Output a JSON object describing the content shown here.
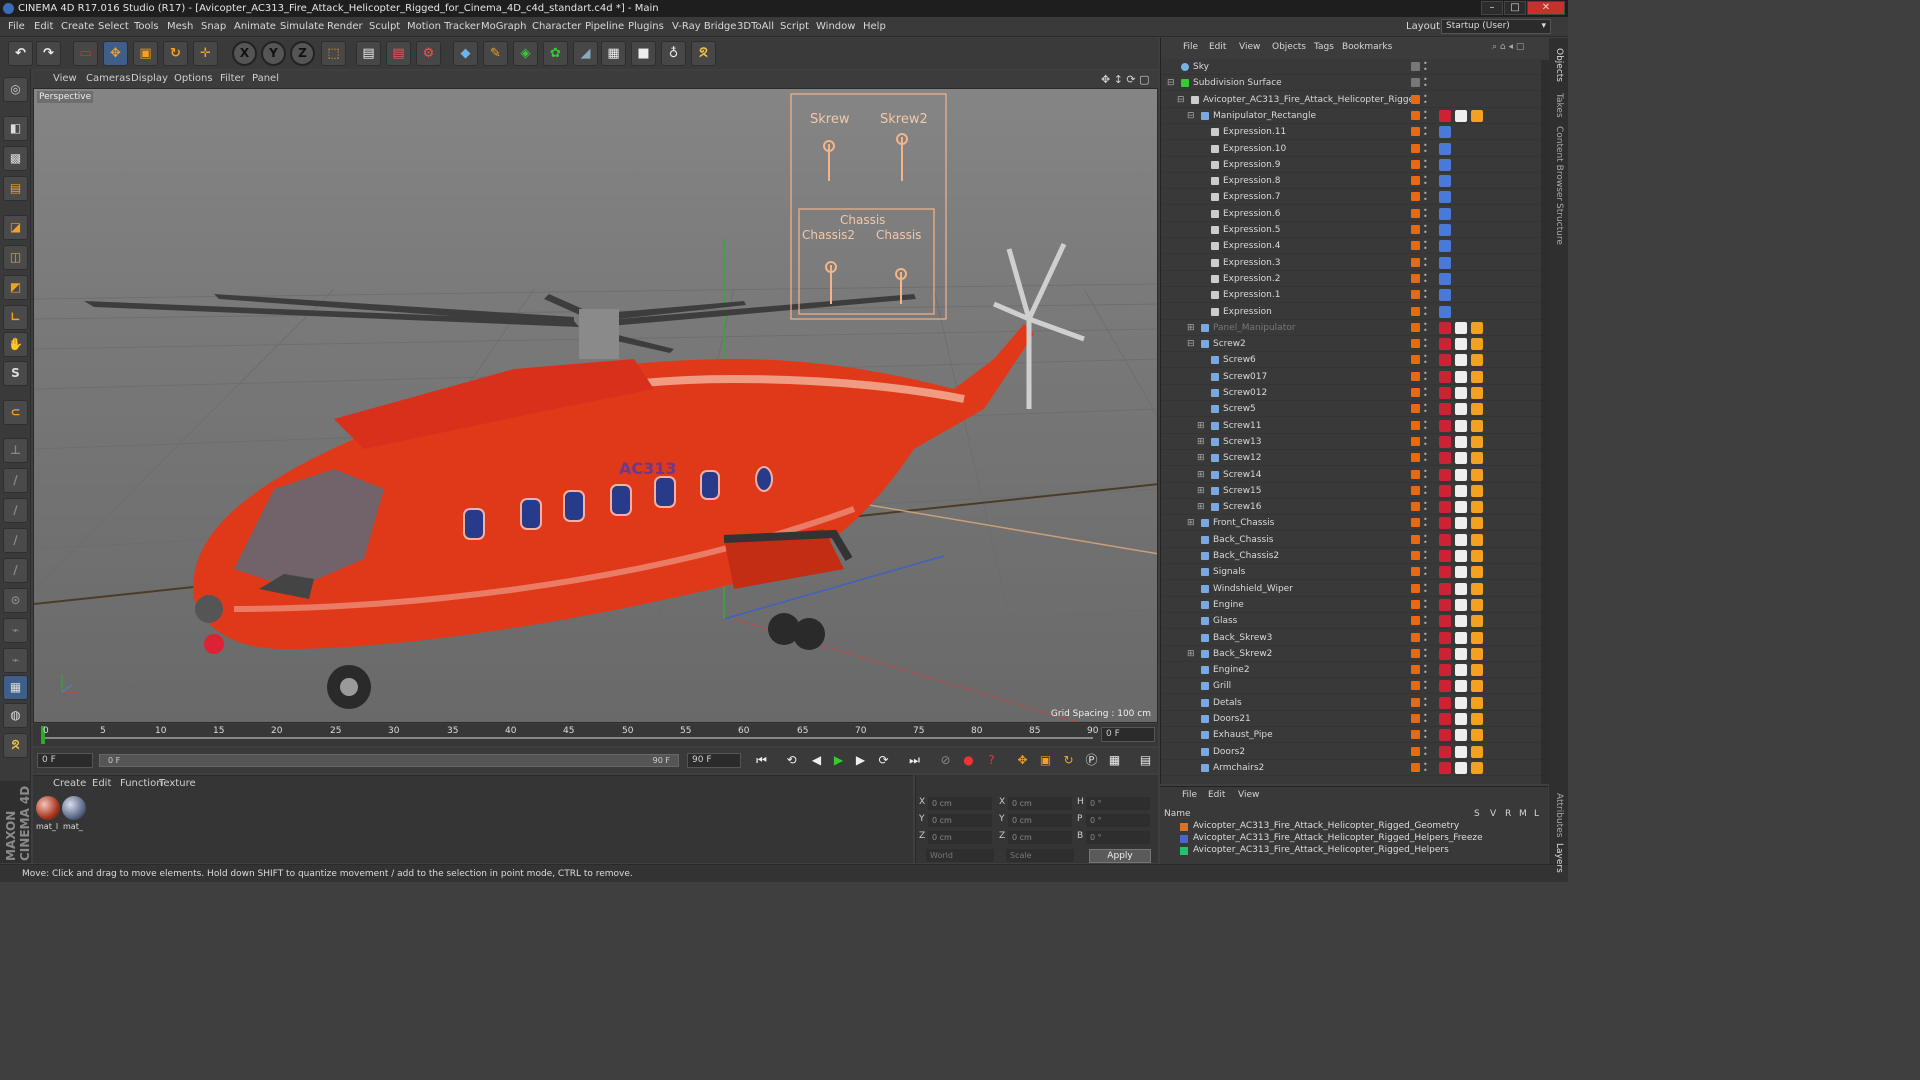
{
  "window": {
    "title": "CINEMA 4D R17.016 Studio (R17) - [Avicopter_AC313_Fire_Attack_Helicopter_Rigged_for_Cinema_4D_c4d_standart.c4d *] - Main"
  },
  "menubar": {
    "items": [
      "File",
      "Edit",
      "Create",
      "Select",
      "Tools",
      "Mesh",
      "Snap",
      "Animate",
      "Simulate",
      "Render",
      "Sculpt",
      "Motion Tracker",
      "MoGraph",
      "Character",
      "Pipeline",
      "Plugins",
      "V-Ray Bridge",
      "3DToAll",
      "Script",
      "Window",
      "Help"
    ],
    "layout_label": "Layout:",
    "layout_value": "Startup (User)"
  },
  "toolbar": {
    "axis_x": "X",
    "axis_y": "Y",
    "axis_z": "Z"
  },
  "viewport": {
    "menu": [
      "View",
      "Cameras",
      "Display",
      "Options",
      "Filter",
      "Panel"
    ],
    "camera_label": "Perspective",
    "grid_spacing": "Grid Spacing : 100 cm",
    "hud": {
      "skrew": "Skrew",
      "skrew2": "Skrew2",
      "chassis": "Chassis",
      "chassis2": "Chassis2",
      "chassis_b": "Chassis"
    },
    "fuselage_text": "AC313"
  },
  "timeline": {
    "ticks": [
      "0",
      "5",
      "10",
      "15",
      "20",
      "25",
      "30",
      "35",
      "40",
      "45",
      "50",
      "55",
      "60",
      "65",
      "70",
      "75",
      "80",
      "85",
      "90"
    ],
    "frame_end_field": "0 F"
  },
  "transport": {
    "start_field": "0 F",
    "range_start": "0 F",
    "range_end": "90 F",
    "end_field": "90 F"
  },
  "material_panel": {
    "menu": [
      "Create",
      "Edit",
      "Function",
      "Texture"
    ],
    "materials": [
      "mat_l",
      "mat_"
    ]
  },
  "coords": {
    "rows": [
      {
        "a": "X",
        "av": "0 cm",
        "b": "X",
        "bv": "0 cm",
        "c": "H",
        "cv": "0 °"
      },
      {
        "a": "Y",
        "av": "0 cm",
        "b": "Y",
        "bv": "0 cm",
        "c": "P",
        "cv": "0 °"
      },
      {
        "a": "Z",
        "av": "0 cm",
        "b": "Z",
        "bv": "0 cm",
        "c": "B",
        "cv": "0 °"
      }
    ],
    "world": "World",
    "scale": "Scale",
    "apply": "Apply"
  },
  "brand": "MAXON CINEMA 4D",
  "status": "Move: Click and drag to move elements. Hold down SHIFT to quantize movement / add to the selection in point mode, CTRL to remove.",
  "object_manager": {
    "menu": [
      "File",
      "Edit",
      "View",
      "Objects",
      "Tags",
      "Bookmarks"
    ],
    "objects": [
      {
        "name": "Sky",
        "indent": 0,
        "icon": "sky"
      },
      {
        "name": "Subdivision Surface",
        "indent": 0,
        "icon": "subdiv",
        "toggle": "−"
      },
      {
        "name": "Avicopter_AC313_Fire_Attack_Helicopter_Rigged",
        "indent": 1,
        "icon": "null",
        "toggle": "−"
      },
      {
        "name": "Manipulator_Rectangle",
        "indent": 2,
        "icon": "joint",
        "toggle": "−"
      },
      {
        "name": "Expression.11",
        "indent": 3,
        "icon": "null"
      },
      {
        "name": "Expression.10",
        "indent": 3,
        "icon": "null"
      },
      {
        "name": "Expression.9",
        "indent": 3,
        "icon": "null"
      },
      {
        "name": "Expression.8",
        "indent": 3,
        "icon": "null"
      },
      {
        "name": "Expression.7",
        "indent": 3,
        "icon": "null"
      },
      {
        "name": "Expression.6",
        "indent": 3,
        "icon": "null"
      },
      {
        "name": "Expression.5",
        "indent": 3,
        "icon": "null"
      },
      {
        "name": "Expression.4",
        "indent": 3,
        "icon": "null"
      },
      {
        "name": "Expression.3",
        "indent": 3,
        "icon": "null"
      },
      {
        "name": "Expression.2",
        "indent": 3,
        "icon": "null"
      },
      {
        "name": "Expression.1",
        "indent": 3,
        "icon": "null"
      },
      {
        "name": "Expression",
        "indent": 3,
        "icon": "null"
      },
      {
        "name": "Panel_Manipulator",
        "indent": 2,
        "icon": "joint",
        "toggle": "+",
        "dim": true
      },
      {
        "name": "Screw2",
        "indent": 2,
        "icon": "joint",
        "toggle": "−"
      },
      {
        "name": "Screw6",
        "indent": 3,
        "icon": "joint"
      },
      {
        "name": "Screw017",
        "indent": 3,
        "icon": "joint"
      },
      {
        "name": "Screw012",
        "indent": 3,
        "icon": "joint"
      },
      {
        "name": "Screw5",
        "indent": 3,
        "icon": "joint"
      },
      {
        "name": "Screw11",
        "indent": 3,
        "icon": "joint",
        "toggle": "+"
      },
      {
        "name": "Screw13",
        "indent": 3,
        "icon": "joint",
        "toggle": "+"
      },
      {
        "name": "Screw12",
        "indent": 3,
        "icon": "joint",
        "toggle": "+"
      },
      {
        "name": "Screw14",
        "indent": 3,
        "icon": "joint",
        "toggle": "+"
      },
      {
        "name": "Screw15",
        "indent": 3,
        "icon": "joint",
        "toggle": "+"
      },
      {
        "name": "Screw16",
        "indent": 3,
        "icon": "joint",
        "toggle": "+"
      },
      {
        "name": "Front_Chassis",
        "indent": 2,
        "icon": "joint",
        "toggle": "+"
      },
      {
        "name": "Back_Chassis",
        "indent": 2,
        "icon": "joint"
      },
      {
        "name": "Back_Chassis2",
        "indent": 2,
        "icon": "joint"
      },
      {
        "name": "Signals",
        "indent": 2,
        "icon": "joint"
      },
      {
        "name": "Windshield_Wiper",
        "indent": 2,
        "icon": "joint"
      },
      {
        "name": "Engine",
        "indent": 2,
        "icon": "joint"
      },
      {
        "name": "Glass",
        "indent": 2,
        "icon": "joint"
      },
      {
        "name": "Back_Skrew3",
        "indent": 2,
        "icon": "joint"
      },
      {
        "name": "Back_Skrew2",
        "indent": 2,
        "icon": "joint",
        "toggle": "+"
      },
      {
        "name": "Engine2",
        "indent": 2,
        "icon": "joint"
      },
      {
        "name": "Grill",
        "indent": 2,
        "icon": "joint"
      },
      {
        "name": "Detals",
        "indent": 2,
        "icon": "joint"
      },
      {
        "name": "Doors21",
        "indent": 2,
        "icon": "joint"
      },
      {
        "name": "Exhaust_Pipe",
        "indent": 2,
        "icon": "joint"
      },
      {
        "name": "Doors2",
        "indent": 2,
        "icon": "joint"
      },
      {
        "name": "Armchairs2",
        "indent": 2,
        "icon": "joint"
      }
    ]
  },
  "layer_manager": {
    "menu": [
      "File",
      "Edit",
      "View"
    ],
    "header_name": "Name",
    "header_cols": [
      "S",
      "V",
      "R",
      "M",
      "L"
    ],
    "layers": [
      {
        "name": "Avicopter_AC313_Fire_Attack_Helicopter_Rigged_Geometry",
        "color": "#d8742a"
      },
      {
        "name": "Avicopter_AC313_Fire_Attack_Helicopter_Rigged_Helpers_Freeze",
        "color": "#4a66c8"
      },
      {
        "name": "Avicopter_AC313_Fire_Attack_Helicopter_Rigged_Helpers",
        "color": "#22c26a"
      }
    ]
  },
  "side_tabs": [
    "Objects",
    "Takes",
    "Content Browser",
    "Structure",
    "Attributes",
    "Layers"
  ]
}
